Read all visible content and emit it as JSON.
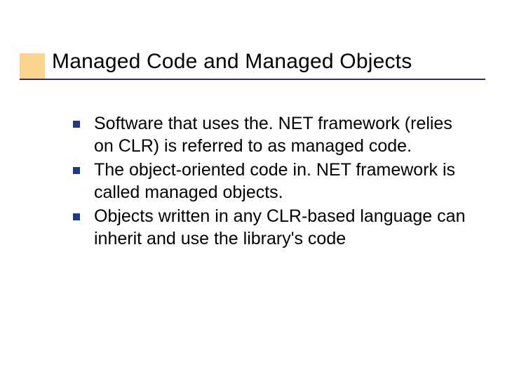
{
  "slide": {
    "title": "Managed Code and Managed Objects",
    "bullets": [
      "Software that uses the. NET framework (relies on CLR) is referred to as managed code.",
      "The object-oriented code in. NET framework is called managed objects.",
      "Objects written in any CLR-based language can inherit and use the library's code"
    ]
  }
}
